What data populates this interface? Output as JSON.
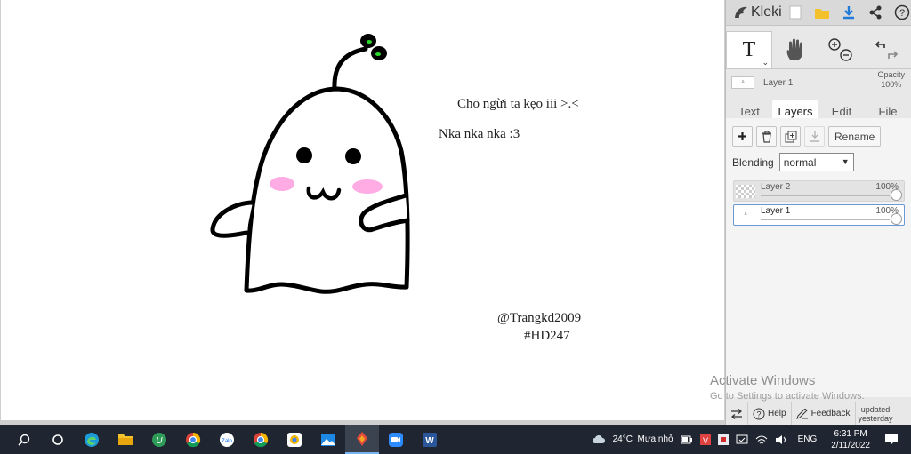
{
  "canvas": {
    "texts": [
      "Cho ngừi ta kẹo iii >.<",
      "Nka nka nka :3",
      "@Trangkd2009",
      "#HD247"
    ]
  },
  "app": {
    "name": "Kleki"
  },
  "tools": {
    "text_tool": "T",
    "active": "text"
  },
  "current_layer": {
    "name": "Layer 1",
    "opacity_label": "Opacity",
    "opacity_value": "100%"
  },
  "tabs": [
    "Text",
    "Layers",
    "Edit",
    "File"
  ],
  "active_tab": "Layers",
  "layers_panel": {
    "rename_label": "Rename",
    "blending_label": "Blending",
    "blending_value": "normal",
    "layers": [
      {
        "name": "Layer 2",
        "opacity": "100%",
        "selected": false
      },
      {
        "name": "Layer 1",
        "opacity": "100%",
        "selected": true
      }
    ]
  },
  "watermark": {
    "title": "Activate Windows",
    "subtitle": "Go to Settings to activate Windows."
  },
  "bottom_bar": {
    "help": "Help",
    "feedback": "Feedback",
    "updated": "updated",
    "updated_when": "yesterday"
  },
  "taskbar": {
    "weather": "24°C  Mưa nhỏ",
    "language": "ENG",
    "time": "6:31 PM",
    "date": "2/11/2022",
    "apps": [
      "search-icon",
      "task-view-icon",
      "edge-icon",
      "file-explorer-icon",
      "coccoc-icon",
      "chrome-icon",
      "zalo-icon",
      "chrome-icon",
      "chrome-canary-icon",
      "photos-icon",
      "kleki-icon",
      "zoom-icon",
      "word-icon"
    ]
  },
  "colors": {
    "accent": "#1f7ad8",
    "taskbar": "#202631",
    "sprout": "#2bd92b",
    "blush": "#ff9ee0"
  }
}
